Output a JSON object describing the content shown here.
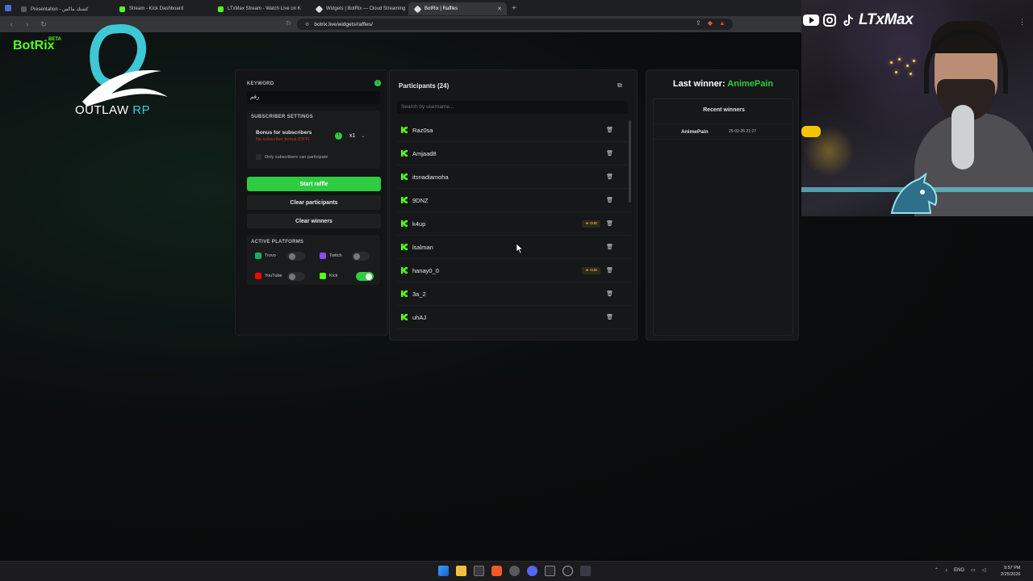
{
  "browser": {
    "tabs": [
      {
        "label": "Presentation - كشتك ماكس",
        "active": false,
        "color": "#c8c8c8"
      },
      {
        "label": "Stream - Kick Dashboard",
        "active": false,
        "color": "#53fc18"
      },
      {
        "label": "LTxMax Stream - Watch Live on K",
        "active": false,
        "color": "#53fc18"
      },
      {
        "label": "Widgets | BotRix — Cloud Streaming",
        "active": false,
        "color": "#ffffff"
      },
      {
        "label": "BotRix | Raffles",
        "active": true,
        "color": "#ffffff"
      }
    ],
    "url": "botrix.live/widgets/raffles/",
    "new_tab": "+"
  },
  "brand": {
    "name": "BotRix",
    "beta": "BETA",
    "logo_text": "OUTLAW",
    "logo_text_accent": "RP"
  },
  "keyword": {
    "label": "KEYWORD",
    "value": "رقم"
  },
  "subscriber_settings": {
    "title": "SUBSCRIBER SETTINGS",
    "bonus_label": "Bonus for subscribers",
    "bonus_status": "No subscriber bonus (OFF)",
    "multiplier": "x1",
    "only_subscribers": "Only subscribers can participate"
  },
  "buttons": {
    "start": "Start raffle",
    "clear_participants": "Clear participants",
    "clear_winners": "Clear winners"
  },
  "platforms": {
    "title": "ACTIVE PLATFORMS",
    "items": [
      {
        "name": "Trovo",
        "color": "#1aab6c",
        "enabled": false
      },
      {
        "name": "Twitch",
        "color": "#9146ff",
        "enabled": false
      },
      {
        "name": "YouTube",
        "color": "#ff0000",
        "enabled": false
      },
      {
        "name": "Kick",
        "color": "#53fc18",
        "enabled": true
      }
    ]
  },
  "participants": {
    "title": "Participants (24)",
    "search_placeholder": "Search by username...",
    "sub_badge": "SUB",
    "items": [
      {
        "name": "Raz0sa",
        "sub": false
      },
      {
        "name": "Amjaad8",
        "sub": false
      },
      {
        "name": "itsnadiamoha",
        "sub": false
      },
      {
        "name": "9DNZ",
        "sub": false
      },
      {
        "name": "k4up",
        "sub": true
      },
      {
        "name": "lsalman",
        "sub": false
      },
      {
        "name": "hanay0_0",
        "sub": true
      },
      {
        "name": "3a_2",
        "sub": false
      },
      {
        "name": "uhAJ",
        "sub": false
      }
    ]
  },
  "winners": {
    "last_label": "Last winner:",
    "last_name": "AnimePain",
    "recent_title": "Recent winners",
    "recent": [
      {
        "name": "AnimePain",
        "date": "25-02-26 21:27"
      }
    ]
  },
  "overlay": {
    "handle": "LTxMax"
  },
  "taskbar": {
    "lang": "ENG",
    "time": "9:57 PM",
    "date": "2/25/2026"
  },
  "colors": {
    "accent_green": "#2ecc40",
    "kick_green": "#53fc18",
    "logo_cyan": "#3ec7d4"
  }
}
